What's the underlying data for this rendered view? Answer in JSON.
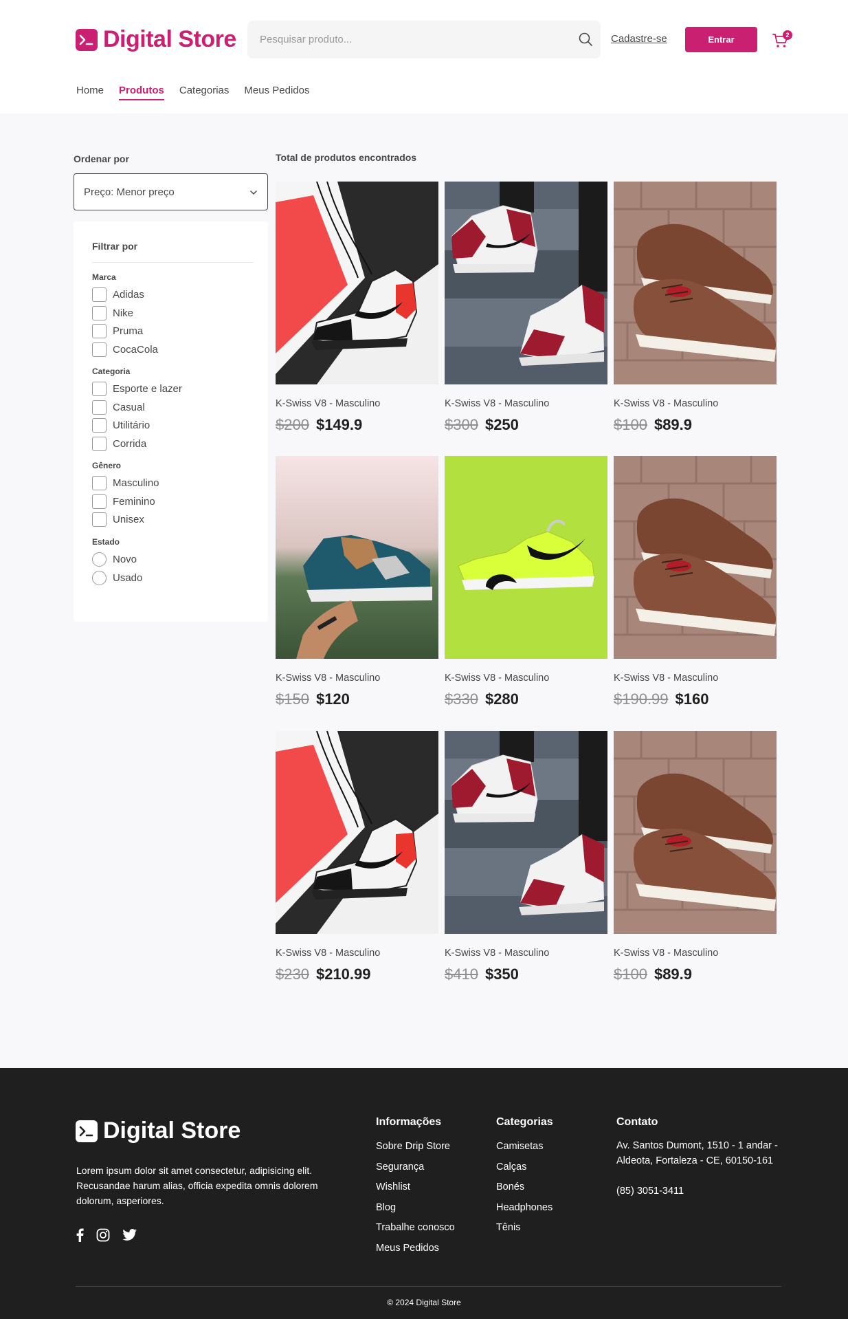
{
  "header": {
    "logo_text": "Digital Store",
    "search_placeholder": "Pesquisar produto...",
    "signup_label": "Cadastre-se",
    "login_label": "Entrar",
    "cart_count": "2",
    "nav": [
      {
        "label": "Home",
        "active": false
      },
      {
        "label": "Produtos",
        "active": true
      },
      {
        "label": "Categorias",
        "active": false
      },
      {
        "label": "Meus Pedidos",
        "active": false
      }
    ]
  },
  "sidebar": {
    "sort_label": "Ordenar por",
    "sort_value": "Preço: Menor preço",
    "filter_title": "Filtrar por",
    "groups": [
      {
        "title": "Marca",
        "type": "checkbox",
        "options": [
          "Adidas",
          "Nike",
          "Pruma",
          "CocaCola"
        ]
      },
      {
        "title": "Categoria",
        "type": "checkbox",
        "options": [
          "Esporte e lazer",
          "Casual",
          "Utilitário",
          "Corrida"
        ]
      },
      {
        "title": "Gênero",
        "type": "checkbox",
        "options": [
          "Masculino",
          "Feminino",
          "Unisex"
        ]
      },
      {
        "title": "Estado",
        "type": "radio",
        "options": [
          "Novo",
          "Usado"
        ]
      }
    ]
  },
  "results": {
    "title": "Total de produtos encontrados",
    "products": [
      {
        "name": "K-Swiss V8 - Masculino",
        "old_price": "$200",
        "price": "$149.9",
        "image": "jordan-black-white"
      },
      {
        "name": "K-Swiss V8 - Masculino",
        "old_price": "$300",
        "price": "$250",
        "image": "jordan-red-steps"
      },
      {
        "name": "K-Swiss V8 - Masculino",
        "old_price": "$100",
        "price": "$89.9",
        "image": "brown-sneakers"
      },
      {
        "name": "K-Swiss V8 - Masculino",
        "old_price": "$150",
        "price": "$120",
        "image": "blue-tan-sneaker-hand"
      },
      {
        "name": "K-Swiss V8 - Masculino",
        "old_price": "$330",
        "price": "$280",
        "image": "neon-nike"
      },
      {
        "name": "K-Swiss V8 - Masculino",
        "old_price": "$190.99",
        "price": "$160",
        "image": "brown-sneakers"
      },
      {
        "name": "K-Swiss V8 - Masculino",
        "old_price": "$230",
        "price": "$210.99",
        "image": "jordan-black-white"
      },
      {
        "name": "K-Swiss V8 - Masculino",
        "old_price": "$410",
        "price": "$350",
        "image": "jordan-red-steps"
      },
      {
        "name": "K-Swiss V8 - Masculino",
        "old_price": "$100",
        "price": "$89.9",
        "image": "brown-sneakers"
      }
    ]
  },
  "footer": {
    "logo_text": "Digital Store",
    "description": "Lorem ipsum dolor sit amet consectetur, adipisicing elit. Recusandae harum alias, officia expedita omnis dolorem dolorum, asperiores.",
    "social": [
      "facebook-icon",
      "instagram-icon",
      "twitter-icon"
    ],
    "info_title": "Informações",
    "info_links": [
      "Sobre Drip Store",
      "Segurança",
      "Wishlist",
      "Blog",
      "Trabalhe conosco",
      "Meus Pedidos"
    ],
    "categories_title": "Categorias",
    "categories_links": [
      "Camisetas",
      "Calças",
      "Bonés",
      "Headphones",
      "Tênis"
    ],
    "contact_title": "Contato",
    "address": "Av. Santos Dumont, 1510 - 1 andar - Aldeota, Fortaleza - CE, 60150-161",
    "phone": "(85) 3051-3411",
    "copyright": "© 2024 Digital Store"
  },
  "colors": {
    "primary": "#c92071",
    "dark": "#1f1f1f",
    "text": "#474747",
    "background": "#f8f8fb"
  }
}
